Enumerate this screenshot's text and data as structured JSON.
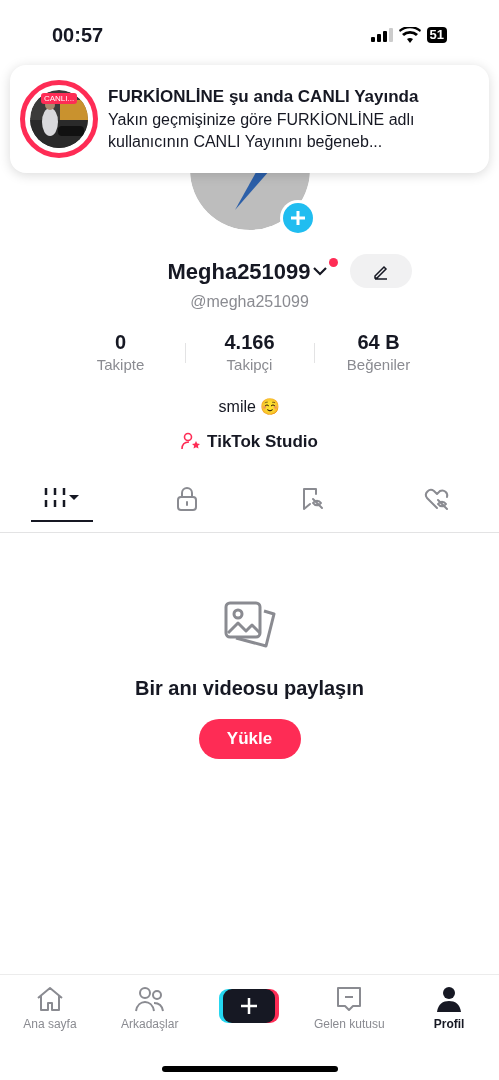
{
  "status_bar": {
    "time": "00:57",
    "battery": "51"
  },
  "notification": {
    "badge": "CANLI...",
    "title": "FURKİONLİNE şu anda CANLI Yayında",
    "body": "Yakın geçmişinize göre FURKİONLİNE adlı kullanıcının CANLI Yayınını beğeneb..."
  },
  "profile": {
    "username": "Megha251099",
    "handle": "@megha251099",
    "bio": "smile ☺️",
    "studio": "TikTok Studio"
  },
  "stats": [
    {
      "value": "0",
      "label": "Takipte"
    },
    {
      "value": "4.166",
      "label": "Takipçi"
    },
    {
      "value": "64 B",
      "label": "Beğeniler"
    }
  ],
  "tabs": [
    {
      "kind": "videos",
      "selected": true
    },
    {
      "kind": "private",
      "selected": false
    },
    {
      "kind": "saved",
      "selected": false
    },
    {
      "kind": "liked",
      "selected": false
    }
  ],
  "empty_state": {
    "message": "Bir anı videosu paylaşın",
    "button": "Yükle"
  },
  "nav": [
    {
      "kind": "home",
      "label": "Ana sayfa",
      "selected": false
    },
    {
      "kind": "friends",
      "label": "Arkadaşlar",
      "selected": false
    },
    {
      "kind": "create"
    },
    {
      "kind": "inbox",
      "label": "Gelen kutusu",
      "selected": false
    },
    {
      "kind": "profile",
      "label": "Profil",
      "selected": true
    }
  ]
}
